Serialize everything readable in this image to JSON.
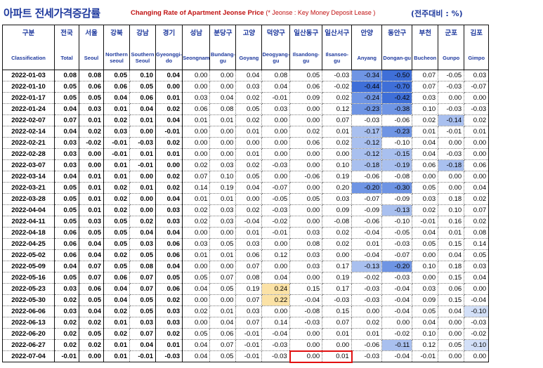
{
  "title": {
    "korean": "아파트 전세가격증감률",
    "english": "Changing Rate of Apartment Jeonse Price",
    "note": "(* Jeonse : Key Money Deposit Lease )",
    "unit": "(전주대비 : %)"
  },
  "columns": [
    {
      "ko": "구분",
      "en": "Classification"
    },
    {
      "ko": "전국",
      "en": "Total"
    },
    {
      "ko": "서울",
      "en": "Seoul"
    },
    {
      "ko": "강북",
      "en": "Northern seoul"
    },
    {
      "ko": "강남",
      "en": "Southern Seoul"
    },
    {
      "ko": "경기",
      "en": "Gyeonggi-do"
    },
    {
      "ko": "성남",
      "en": "Seongnam"
    },
    {
      "ko": "분당구",
      "en": "Bundang-gu"
    },
    {
      "ko": "고양",
      "en": "Goyang"
    },
    {
      "ko": "덕양구",
      "en": "Deogyang-gu"
    },
    {
      "ko": "일산동구",
      "en": "Ilsandong-gu"
    },
    {
      "ko": "일산서구",
      "en": "Ilsanseo-gu"
    },
    {
      "ko": "안양",
      "en": "Anyang"
    },
    {
      "ko": "동안구",
      "en": "Dongan-gu"
    },
    {
      "ko": "부천",
      "en": "Bucheon"
    },
    {
      "ko": "군포",
      "en": "Gunpo"
    },
    {
      "ko": "김포",
      "en": "Gimpo"
    }
  ],
  "rows": [
    [
      "2022-01-03",
      "0.08",
      "0.08",
      "0.05",
      "0.10",
      "0.04",
      "0.00",
      "0.00",
      "0.04",
      "0.08",
      "0.05",
      "-0.03",
      "-0.34",
      "-0.50",
      "0.07",
      "-0.05",
      "0.03"
    ],
    [
      "2022-01-10",
      "0.05",
      "0.06",
      "0.06",
      "0.05",
      "0.00",
      "0.00",
      "0.00",
      "0.03",
      "0.04",
      "0.06",
      "-0.02",
      "-0.44",
      "-0.70",
      "0.07",
      "-0.03",
      "-0.07"
    ],
    [
      "2022-01-17",
      "0.05",
      "0.05",
      "0.04",
      "0.06",
      "0.01",
      "0.03",
      "0.04",
      "0.02",
      "-0.01",
      "0.09",
      "0.02",
      "-0.24",
      "-0.42",
      "0.03",
      "0.00",
      "0.00"
    ],
    [
      "2022-01-24",
      "0.04",
      "0.03",
      "0.01",
      "0.04",
      "0.02",
      "0.06",
      "0.08",
      "0.05",
      "0.03",
      "0.00",
      "0.12",
      "-0.23",
      "-0.38",
      "0.10",
      "-0.03",
      "-0.03"
    ],
    [
      "2022-02-07",
      "0.07",
      "0.01",
      "0.02",
      "0.01",
      "0.04",
      "0.01",
      "0.01",
      "0.02",
      "0.00",
      "0.00",
      "0.07",
      "-0.03",
      "-0.06",
      "0.02",
      "-0.14",
      "0.02"
    ],
    [
      "2022-02-14",
      "0.04",
      "0.02",
      "0.03",
      "0.00",
      "-0.01",
      "0.00",
      "0.00",
      "0.01",
      "0.00",
      "0.02",
      "0.01",
      "-0.17",
      "-0.23",
      "0.01",
      "-0.01",
      "0.01"
    ],
    [
      "2022-02-21",
      "0.03",
      "-0.02",
      "-0.01",
      "-0.03",
      "0.02",
      "0.00",
      "0.00",
      "0.00",
      "0.00",
      "0.06",
      "0.02",
      "-0.12",
      "-0.10",
      "0.04",
      "0.00",
      "0.00"
    ],
    [
      "2022-02-28",
      "0.03",
      "0.00",
      "-0.01",
      "0.01",
      "0.01",
      "0.00",
      "0.00",
      "0.01",
      "0.00",
      "0.00",
      "0.00",
      "-0.12",
      "-0.15",
      "0.04",
      "-0.03",
      "0.00"
    ],
    [
      "2022-03-07",
      "0.03",
      "0.00",
      "0.01",
      "-0.01",
      "0.00",
      "0.02",
      "0.03",
      "0.02",
      "-0.03",
      "0.00",
      "0.10",
      "-0.18",
      "-0.19",
      "0.06",
      "-0.18",
      "0.06"
    ],
    [
      "2022-03-14",
      "0.04",
      "0.01",
      "0.01",
      "0.00",
      "0.02",
      "0.07",
      "0.10",
      "0.05",
      "0.00",
      "-0.06",
      "0.19",
      "-0.06",
      "-0.08",
      "0.00",
      "0.00",
      "0.00"
    ],
    [
      "2022-03-21",
      "0.05",
      "0.01",
      "0.02",
      "0.01",
      "0.02",
      "0.14",
      "0.19",
      "0.04",
      "-0.07",
      "0.00",
      "0.20",
      "-0.20",
      "-0.30",
      "0.05",
      "0.00",
      "0.04"
    ],
    [
      "2022-03-28",
      "0.05",
      "0.01",
      "0.02",
      "0.00",
      "0.04",
      "0.01",
      "0.01",
      "0.00",
      "-0.05",
      "0.05",
      "0.03",
      "-0.07",
      "-0.09",
      "0.03",
      "0.18",
      "0.02"
    ],
    [
      "2022-04-04",
      "0.05",
      "0.01",
      "0.02",
      "0.00",
      "0.03",
      "0.02",
      "0.03",
      "0.02",
      "-0.03",
      "0.00",
      "0.09",
      "-0.09",
      "-0.13",
      "0.02",
      "0.10",
      "0.07"
    ],
    [
      "2022-04-11",
      "0.05",
      "0.03",
      "0.05",
      "0.02",
      "0.03",
      "0.02",
      "0.03",
      "-0.04",
      "-0.02",
      "0.00",
      "-0.08",
      "-0.06",
      "-0.10",
      "-0.01",
      "0.16",
      "0.02"
    ],
    [
      "2022-04-18",
      "0.06",
      "0.05",
      "0.05",
      "0.04",
      "0.04",
      "0.00",
      "0.00",
      "0.01",
      "-0.01",
      "0.03",
      "0.02",
      "-0.04",
      "-0.05",
      "0.04",
      "0.01",
      "0.08"
    ],
    [
      "2022-04-25",
      "0.06",
      "0.04",
      "0.05",
      "0.03",
      "0.06",
      "0.03",
      "0.05",
      "0.03",
      "0.00",
      "0.08",
      "0.02",
      "0.01",
      "-0.03",
      "0.05",
      "0.15",
      "0.14"
    ],
    [
      "2022-05-02",
      "0.06",
      "0.04",
      "0.02",
      "0.05",
      "0.06",
      "0.01",
      "0.01",
      "0.06",
      "0.12",
      "0.03",
      "0.00",
      "-0.04",
      "-0.07",
      "0.00",
      "0.04",
      "0.05"
    ],
    [
      "2022-05-09",
      "0.04",
      "0.07",
      "0.05",
      "0.08",
      "0.04",
      "0.00",
      "0.00",
      "0.07",
      "0.00",
      "0.03",
      "0.17",
      "-0.13",
      "-0.20",
      "0.10",
      "0.18",
      "0.03"
    ],
    [
      "2022-05-16",
      "0.05",
      "0.07",
      "0.06",
      "0.07",
      "0.05",
      "0.05",
      "0.07",
      "0.08",
      "0.04",
      "0.00",
      "0.19",
      "-0.02",
      "-0.03",
      "0.00",
      "0.15",
      "0.04"
    ],
    [
      "2022-05-23",
      "0.03",
      "0.06",
      "0.04",
      "0.07",
      "0.06",
      "0.04",
      "0.05",
      "0.19",
      "0.24",
      "0.15",
      "0.17",
      "-0.03",
      "-0.04",
      "0.03",
      "0.06",
      "0.00"
    ],
    [
      "2022-05-30",
      "0.02",
      "0.05",
      "0.04",
      "0.05",
      "0.02",
      "0.00",
      "0.00",
      "0.07",
      "0.22",
      "-0.04",
      "-0.03",
      "-0.03",
      "-0.04",
      "0.09",
      "0.15",
      "-0.04"
    ],
    [
      "2022-06-06",
      "0.03",
      "0.04",
      "0.02",
      "0.05",
      "0.03",
      "0.02",
      "0.01",
      "0.03",
      "0.00",
      "-0.08",
      "0.15",
      "0.00",
      "-0.04",
      "0.05",
      "0.04",
      "-0.10"
    ],
    [
      "2022-06-13",
      "0.02",
      "0.02",
      "0.01",
      "0.03",
      "0.03",
      "0.00",
      "0.04",
      "0.07",
      "0.14",
      "-0.03",
      "0.07",
      "0.02",
      "0.00",
      "0.04",
      "0.00",
      "-0.03"
    ],
    [
      "2022-06-20",
      "0.02",
      "0.05",
      "0.02",
      "0.07",
      "0.02",
      "0.05",
      "0.06",
      "-0.01",
      "-0.04",
      "0.00",
      "0.01",
      "0.01",
      "-0.02",
      "0.10",
      "0.00",
      "-0.02"
    ],
    [
      "2022-06-27",
      "0.02",
      "0.02",
      "0.01",
      "0.04",
      "0.01",
      "0.04",
      "0.07",
      "-0.01",
      "-0.03",
      "0.00",
      "0.00",
      "-0.06",
      "-0.11",
      "0.12",
      "0.05",
      "-0.10"
    ],
    [
      "2022-07-04",
      "-0.01",
      "0.00",
      "0.01",
      "-0.01",
      "-0.03",
      "0.04",
      "0.05",
      "-0.01",
      "-0.03",
      "0.00",
      "0.01",
      "-0.03",
      "-0.04",
      "-0.01",
      "0.00",
      "0.00"
    ]
  ],
  "colors": {
    "title_blue": "#1f3a9e",
    "title_red": "#c01010",
    "neg_strong": "#3f6fd8",
    "neg_mid": "#6f95e4",
    "neg_light": "#a9c0ef",
    "neg_pale": "#d3e0f8",
    "pos_yellow": "#fbe2a6",
    "highlight_box": "#e11010"
  }
}
